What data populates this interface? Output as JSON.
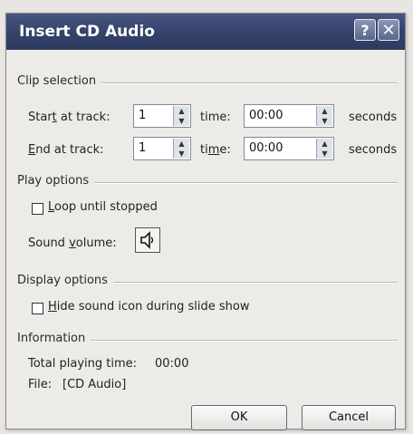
{
  "window": {
    "title": "Insert CD Audio",
    "help_symbol": "?",
    "close_symbol": "✕"
  },
  "clip_selection": {
    "heading": "Clip selection",
    "start_label": "Start at track:",
    "start_track": "1",
    "start_time_label": "time:",
    "start_time": "00:00",
    "start_units": "seconds",
    "end_label": "End at track:",
    "end_track": "1",
    "end_time_label": "time:",
    "end_time": "00:00",
    "end_units": "seconds"
  },
  "play_options": {
    "heading": "Play options",
    "loop_label": "Loop until stopped",
    "loop_checked": false,
    "sound_volume_label": "Sound volume:"
  },
  "display_options": {
    "heading": "Display options",
    "hide_icon_label": "Hide sound icon during slide show",
    "hide_icon_checked": false
  },
  "information": {
    "heading": "Information",
    "total_playing_time_label": "Total playing time:",
    "total_playing_time": "00:00",
    "file_label": "File:",
    "file_value": "[CD Audio]"
  },
  "buttons": {
    "ok": "OK",
    "cancel": "Cancel"
  },
  "icons": {
    "spin_up": "▲",
    "spin_down": "▼",
    "volume": "speaker-icon"
  }
}
